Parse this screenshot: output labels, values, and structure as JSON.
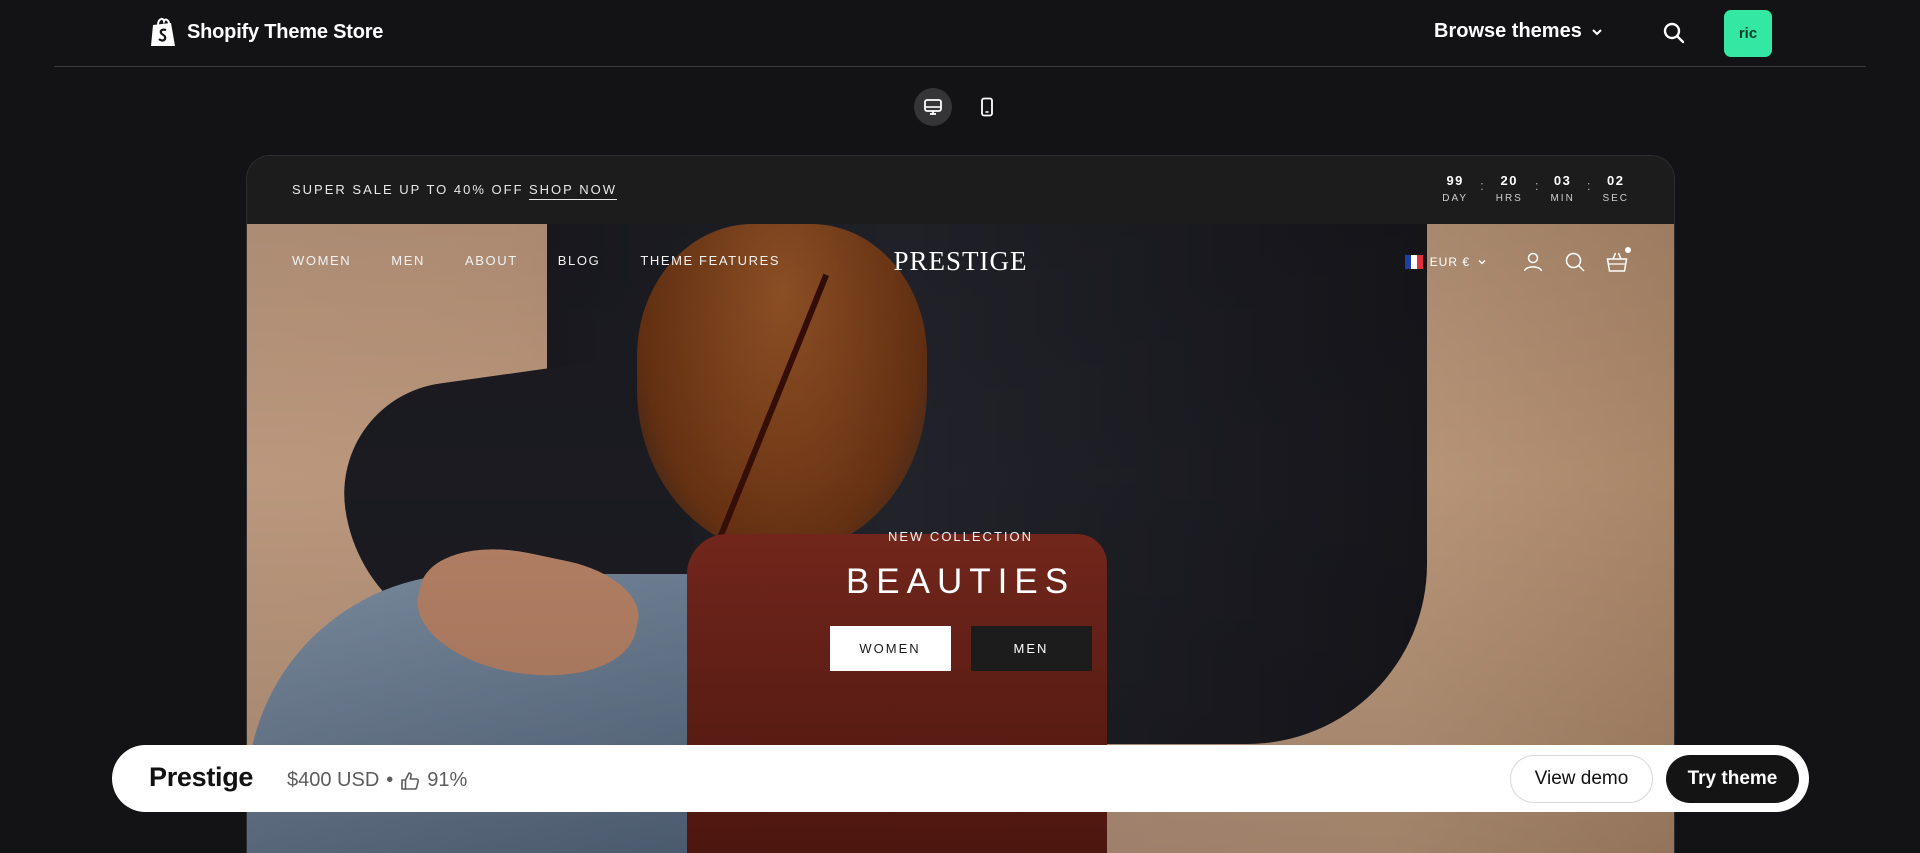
{
  "store_header": {
    "title": "Shopify Theme Store",
    "browse_label": "Browse themes",
    "avatar_initials": "ric",
    "accent": "#34e8a4"
  },
  "device_toggle": {
    "options": [
      "desktop",
      "mobile"
    ],
    "selected": "desktop"
  },
  "preview": {
    "announcement": {
      "text": "SUPER SALE UP TO 40% OFF",
      "link": "SHOP NOW"
    },
    "countdown": [
      {
        "value": "99",
        "label": "DAY"
      },
      {
        "value": "20",
        "label": "HRS"
      },
      {
        "value": "03",
        "label": "MIN"
      },
      {
        "value": "02",
        "label": "SEC"
      }
    ],
    "countdown_separator": ":",
    "nav": [
      "WOMEN",
      "MEN",
      "ABOUT",
      "BLOG",
      "THEME FEATURES"
    ],
    "brand": "PRESTIGE",
    "currency": "EUR €",
    "hero": {
      "eyebrow": "NEW COLLECTION",
      "headline": "BEAUTIES",
      "primary_button": "WOMEN",
      "secondary_button": "MEN"
    }
  },
  "sticky_bar": {
    "theme_name": "Prestige",
    "price": "$400 USD",
    "separator": "•",
    "rating": "91%",
    "view_demo": "View demo",
    "try_theme": "Try theme"
  }
}
